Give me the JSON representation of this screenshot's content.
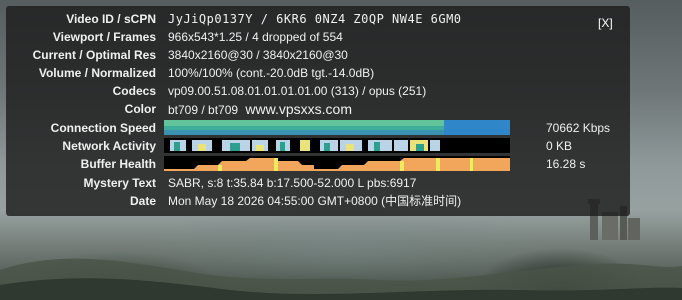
{
  "close_label": "[X]",
  "rows": [
    {
      "label": "Video ID / sCPN",
      "value": "JyJiQp0137Y / 6KR6 0NZ4 Z0QP NW4E 6GM0"
    },
    {
      "label": "Viewport / Frames",
      "value": "966x543*1.25 / 4 dropped of 554"
    },
    {
      "label": "Current / Optimal Res",
      "value": "3840x2160@30 / 3840x2160@30"
    },
    {
      "label": "Volume / Normalized",
      "value": "100%/100% (cont.-20.0dB tgt.-14.0dB)"
    },
    {
      "label": "Codecs",
      "value": "vp09.00.51.08.01.01.01.01.00 (313) / opus (251)"
    },
    {
      "label": "Color",
      "value": "bt709 / bt709"
    }
  ],
  "watermark": "www.vpsxxs.com",
  "graphs": [
    {
      "label": "Connection Speed",
      "value": "70662 Kbps"
    },
    {
      "label": "Network Activity",
      "value": "0 KB"
    },
    {
      "label": "Buffer Health",
      "value": "16.28 s"
    }
  ],
  "rows2": [
    {
      "label": "Mystery Text",
      "value": "SABR, s:8 t:35.84 b:17.500-52.000 L pbs:6917"
    },
    {
      "label": "Date",
      "value": "Mon May 18 2026 04:55:00 GMT+0800 (中国标准时间)"
    }
  ],
  "colors": {
    "connection_green": "#62c49a",
    "connection_blue": "#2f86c9",
    "network_light": "#b9d4e6",
    "network_teal": "#2e9e8e",
    "network_yellow": "#e9e37a",
    "buffer_orange": "#f2a65b",
    "buffer_yellow": "#ecec5e"
  }
}
